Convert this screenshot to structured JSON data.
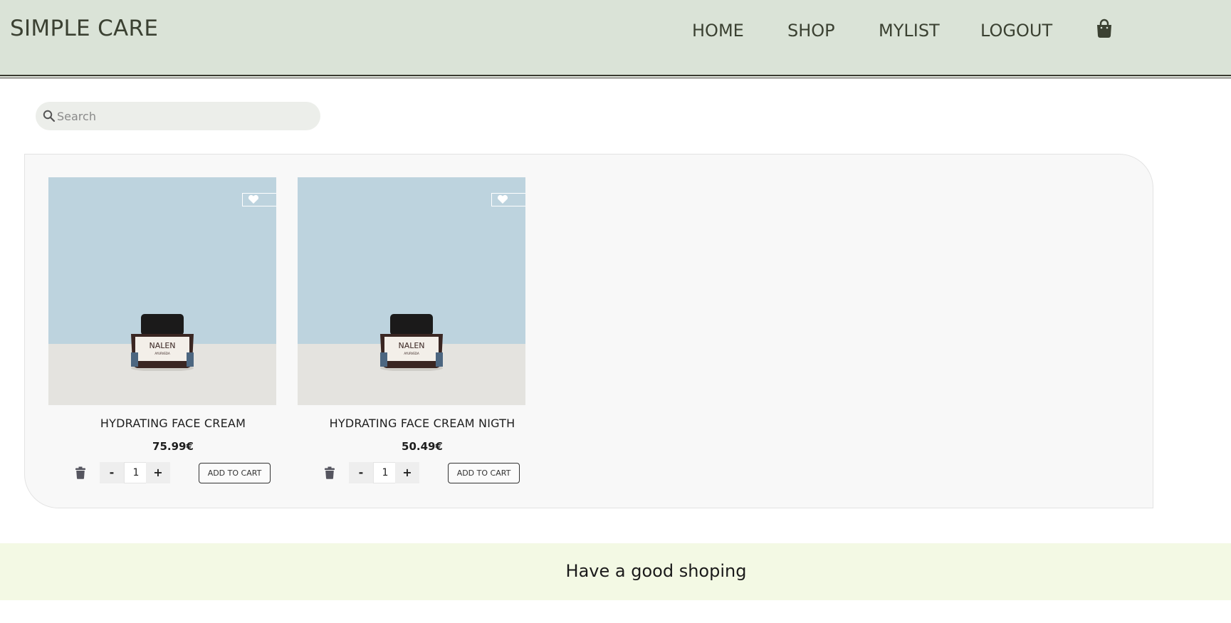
{
  "header": {
    "brand": "SIMPLE CARE",
    "nav": [
      "HOME",
      "SHOP",
      "MYLIST",
      "LOGOUT"
    ],
    "cart_icon": "shopping-bag-icon"
  },
  "search": {
    "placeholder": "Search",
    "value": "",
    "icon": "search-icon"
  },
  "products": [
    {
      "title": "HYDRATING FACE CREAM",
      "price": "75.99€",
      "quantity": "1",
      "minus_label": "-",
      "plus_label": "+",
      "add_label": "ADD TO CART",
      "jar_brand": "NALEN",
      "jar_sub": "AYURVEDA"
    },
    {
      "title": "HYDRATING FACE CREAM NIGTH",
      "price": "50.49€",
      "quantity": "1",
      "minus_label": "-",
      "plus_label": "+",
      "add_label": "ADD TO CART",
      "jar_brand": "NALEN",
      "jar_sub": "AYURVEDA"
    }
  ],
  "footer": {
    "message": "Have a good shoping"
  },
  "colors": {
    "header_bg": "#dae3d7",
    "footer_bg": "#f3f9e4",
    "product_bg": "#bdd3de",
    "text_dark": "#3b4132"
  }
}
